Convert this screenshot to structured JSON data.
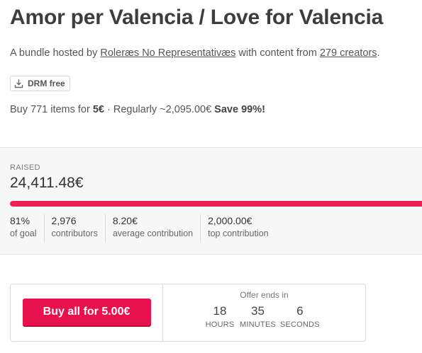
{
  "title": "Amor per Valencia / Love for Valencia",
  "subtitle": {
    "prefix": "A bundle hosted by ",
    "host": "Roleræs No Representativæs",
    "middle": " with content from ",
    "creators": "279 creators",
    "suffix": "."
  },
  "badge": {
    "label": "DRM free",
    "icon": "download-icon"
  },
  "pricing": {
    "prefix": "Buy 771 items for ",
    "price": "5€",
    "regular": " · Regularly ~2,095.00€ ",
    "save": "Save 99%!"
  },
  "raised": {
    "label": "RAISED",
    "amount": "24,411.48€",
    "progress_percent": 100,
    "bar_color": "#ee1f55"
  },
  "stats": [
    {
      "value": "81%",
      "label": "of goal"
    },
    {
      "value": "2,976",
      "label": "contributors"
    },
    {
      "value": "8.20€",
      "label": "average contribution"
    },
    {
      "value": "2,000.00€",
      "label": "top contribution"
    }
  ],
  "buy": {
    "button_label": "Buy all for 5.00€",
    "button_color": "#e9114d"
  },
  "countdown": {
    "label": "Offer ends in",
    "units": [
      {
        "value": "18",
        "unit": "HOURS"
      },
      {
        "value": "35",
        "unit": "MINUTES"
      },
      {
        "value": "6",
        "unit": "SECONDS"
      }
    ]
  }
}
